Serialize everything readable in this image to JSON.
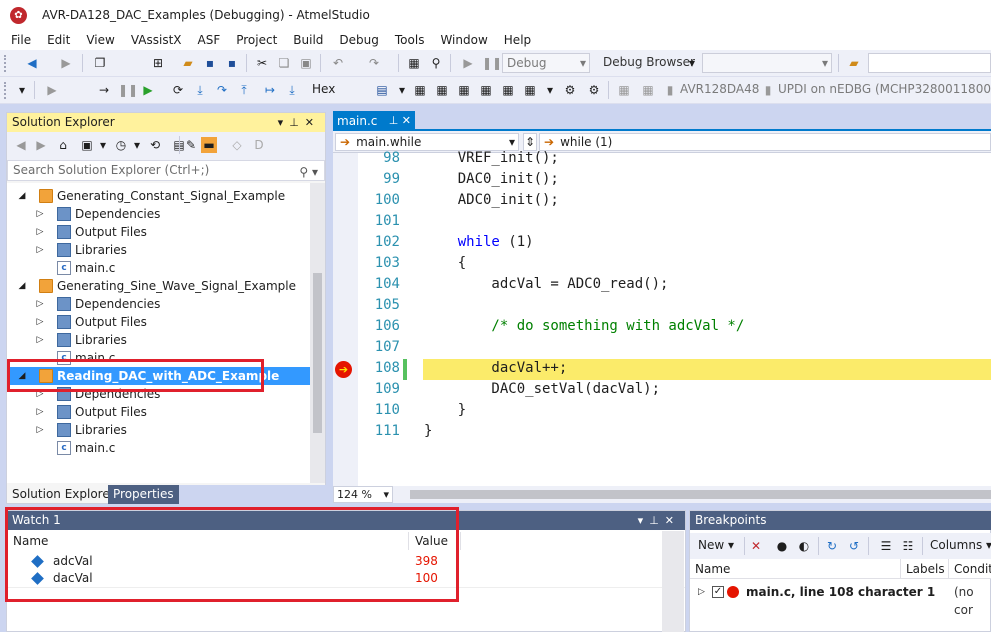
{
  "window": {
    "title": "AVR-DA128_DAC_Examples (Debugging) - AtmelStudio"
  },
  "menu": [
    "File",
    "Edit",
    "View",
    "VAssistX",
    "ASF",
    "Project",
    "Build",
    "Debug",
    "Tools",
    "Window",
    "Help"
  ],
  "toolbar": {
    "config": "Debug",
    "browser": "Debug Browser",
    "hex": "Hex",
    "device": "AVR128DA48",
    "tool": "UPDI on nEDBG (MCHP3280011800000"
  },
  "solution_explorer": {
    "title": "Solution Explorer",
    "search_placeholder": "Search Solution Explorer (Ctrl+;)",
    "tree": [
      {
        "label": "Generating_Constant_Signal_Example",
        "level": 0,
        "kind": "project"
      },
      {
        "label": "Dependencies",
        "level": 1,
        "kind": "folder"
      },
      {
        "label": "Output Files",
        "level": 1,
        "kind": "folder"
      },
      {
        "label": "Libraries",
        "level": 1,
        "kind": "folder"
      },
      {
        "label": "main.c",
        "level": 1,
        "kind": "file"
      },
      {
        "label": "Generating_Sine_Wave_Signal_Example",
        "level": 0,
        "kind": "project"
      },
      {
        "label": "Dependencies",
        "level": 1,
        "kind": "folder"
      },
      {
        "label": "Output Files",
        "level": 1,
        "kind": "folder"
      },
      {
        "label": "Libraries",
        "level": 1,
        "kind": "folder"
      },
      {
        "label": "main.c",
        "level": 1,
        "kind": "file"
      },
      {
        "label": "Reading_DAC_with_ADC_Example",
        "level": 0,
        "kind": "project",
        "selected": true
      },
      {
        "label": "Dependencies",
        "level": 1,
        "kind": "folder"
      },
      {
        "label": "Output Files",
        "level": 1,
        "kind": "folder"
      },
      {
        "label": "Libraries",
        "level": 1,
        "kind": "folder"
      },
      {
        "label": "main.c",
        "level": 1,
        "kind": "file"
      }
    ],
    "tabs": [
      "Solution Explorer",
      "Properties"
    ]
  },
  "editor": {
    "tab": "main.c",
    "nav_scope": "main.while",
    "nav_member": "while (1)",
    "zoom": "124 %",
    "current_line": 108,
    "lines": [
      {
        "n": "98",
        "code": "    VREF_init();"
      },
      {
        "n": "99",
        "code": "    DAC0_init();"
      },
      {
        "n": "100",
        "code": "    ADC0_init();"
      },
      {
        "n": "101",
        "code": ""
      },
      {
        "n": "102",
        "code": "    while (1)"
      },
      {
        "n": "103",
        "code": "    {"
      },
      {
        "n": "104",
        "code": "        adcVal = ADC0_read();"
      },
      {
        "n": "105",
        "code": ""
      },
      {
        "n": "106",
        "code": "        /* do something with adcVal */"
      },
      {
        "n": "107",
        "code": ""
      },
      {
        "n": "108",
        "code": "        dacVal++;"
      },
      {
        "n": "109",
        "code": "        DAC0_setVal(dacVal);"
      },
      {
        "n": "110",
        "code": "    }"
      },
      {
        "n": "111",
        "code": "}"
      }
    ]
  },
  "watch": {
    "title": "Watch 1",
    "col_name": "Name",
    "col_value": "Value",
    "rows": [
      {
        "name": "adcVal",
        "value": "398"
      },
      {
        "name": "dacVal",
        "value": "100"
      }
    ]
  },
  "breakpoints": {
    "title": "Breakpoints",
    "new_label": "New",
    "columns_label": "Columns",
    "col_name": "Name",
    "col_labels": "Labels",
    "col_condition": "Conditi",
    "item": {
      "label": "main.c, line 108 character 1",
      "condition": "(no cor"
    }
  },
  "colors": {
    "accent": "#007acc",
    "selection": "#3399ff",
    "annotation": "#e0202c",
    "current_line": "#fbeb6a"
  }
}
